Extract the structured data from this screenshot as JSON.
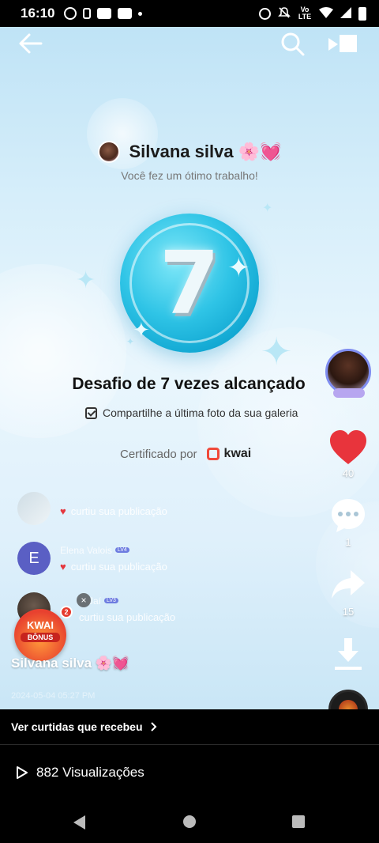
{
  "status_bar": {
    "time": "16:10",
    "network_label": "Vo LTE",
    "icons": [
      "whatsapp-icon",
      "cast-icon",
      "youtube-icon",
      "youtube-icon",
      "dot-icon",
      "alarm-icon",
      "mute-icon",
      "wifi-icon",
      "signal-icon",
      "battery-icon"
    ]
  },
  "header": {
    "author_name": "Silvana silva 🌸💓",
    "subtitle": "Você fez um ótimo trabalho!"
  },
  "badge": {
    "number": "7",
    "color": "#1fb5dd"
  },
  "achievement": {
    "title": "Desafio de 7 vezes alcançado",
    "share_text": "Compartilhe a última foto da sua galeria",
    "certified_by": "Certificado por",
    "brand": "kwai"
  },
  "right_rail": {
    "like_count": "40",
    "comment_count": "1",
    "share_count": "15",
    "like_color": "#e8343c"
  },
  "likes_feed": [
    {
      "avatar_letter": "",
      "name": "",
      "level": "",
      "action": "curtiu sua publicação"
    },
    {
      "avatar_letter": "E",
      "name": "Elena Valois",
      "level": "LV4",
      "action": "curtiu sua publicação"
    },
    {
      "avatar_letter": "",
      "name": "Jaí",
      "level": "LV3",
      "action": "curtiu sua publicação"
    }
  ],
  "kwai_bonus": {
    "title": "KWAI",
    "subtitle": "BÔNUS",
    "count": "2"
  },
  "post": {
    "author": "Silvana silva 🌸💓",
    "date": "2024-05-04 05:27 PM"
  },
  "bottom_sheet": {
    "likes_received_link": "Ver curtidas que recebeu",
    "views": "882 Visualizações"
  }
}
